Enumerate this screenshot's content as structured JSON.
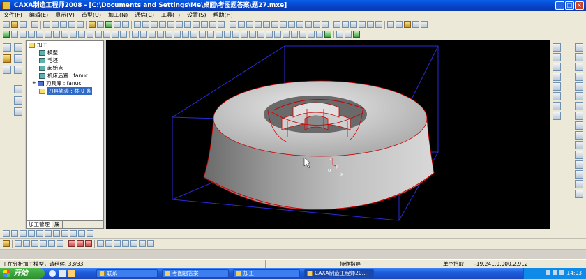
{
  "window": {
    "title": "CAXA制造工程师2008  - [C:\\Documents and Settings\\Me\\桌面\\考图题答案\\题27.mxe]"
  },
  "menu": [
    "文件(F)",
    "编辑(E)",
    "显示(V)",
    "造型(U)",
    "加工(N)",
    "通信(C)",
    "工具(T)",
    "设置(S)",
    "帮助(H)"
  ],
  "tree": {
    "items": [
      {
        "label": "加工",
        "icon": "cam-root-icon"
      },
      {
        "label": "模型",
        "icon": "model-icon"
      },
      {
        "label": "毛坯",
        "icon": "blank-icon"
      },
      {
        "label": "起始点",
        "icon": "start-point-icon"
      },
      {
        "label": "机床后置 : fanuc",
        "icon": "machine-post-icon"
      },
      {
        "label": "刀具库 : fanuc",
        "icon": "tool-library-icon"
      },
      {
        "label": "刀具轨迹 : 共 0 条",
        "icon": "toolpath-folder-icon"
      }
    ],
    "tabs": [
      "加工管理",
      "属"
    ]
  },
  "viewport": {
    "axis_z": "z",
    "axis_y": "y",
    "axis_x": "x",
    "axis_origin": "o"
  },
  "status": {
    "message": "正在分析加工模型，请稍候.",
    "progress": "33/33",
    "prompt": "操作指导",
    "mode": "单个拾取",
    "coords": "-19.241,0.000,2.912"
  },
  "taskbar": {
    "start": "开始",
    "tasks": [
      "联系",
      "考图题答案",
      "加工",
      "CAXA制造工程师20..."
    ],
    "clock": "14:03"
  },
  "colors": {
    "viewport": "#000000",
    "model_edges": "#cc0000",
    "bounding_box": "#2a2ad8",
    "title": "#0642c8"
  }
}
